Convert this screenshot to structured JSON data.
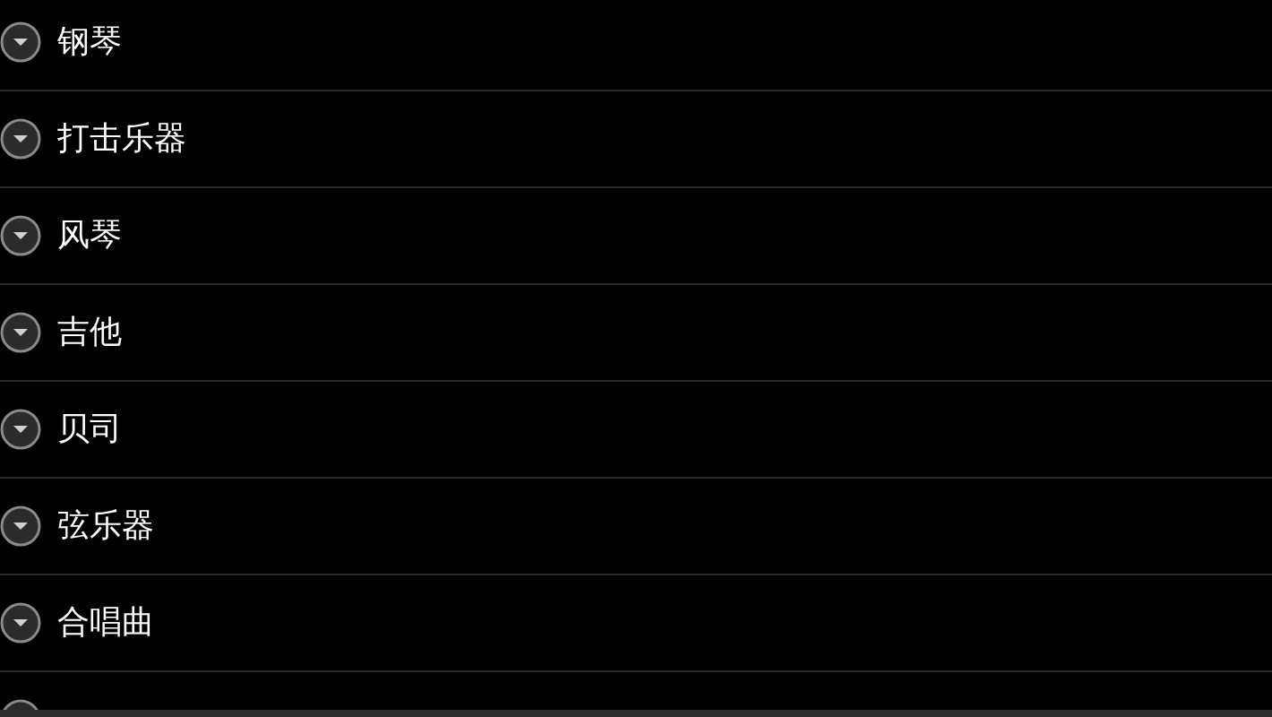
{
  "categories": [
    {
      "kind": "full",
      "label": "钢琴"
    },
    {
      "kind": "full",
      "label": "打击乐器"
    },
    {
      "kind": "full",
      "label": "风琴"
    },
    {
      "kind": "full",
      "label": "吉他"
    },
    {
      "kind": "full",
      "label": "贝司"
    },
    {
      "kind": "full",
      "label": "弦乐器"
    },
    {
      "kind": "full",
      "label": "合唱曲"
    },
    {
      "kind": "cut_off"
    }
  ]
}
